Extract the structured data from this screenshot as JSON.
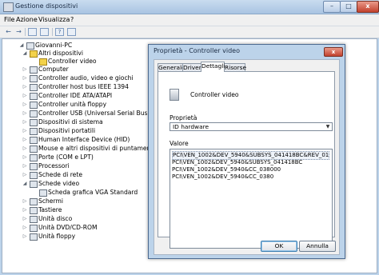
{
  "window": {
    "title": "Gestione dispositivi",
    "min_glyph": "–",
    "max_glyph": "□",
    "close_glyph": "x"
  },
  "menu": {
    "file": "File",
    "azione": "Azione",
    "visualizza": "Visualizza",
    "help": "?"
  },
  "toolbar": {
    "icons": [
      "back-icon",
      "forward-icon",
      "properties-icon",
      "list-icon",
      "help-icon",
      "scan-icon"
    ],
    "back": "←",
    "forward": "→",
    "help": "?"
  },
  "tree": {
    "nodes": [
      {
        "label": "Giovanni-PC",
        "expand": "◢"
      },
      {
        "label": "Altri dispositivi",
        "expand": "◢"
      },
      {
        "label": "Controller video",
        "expand": ""
      },
      {
        "label": "Computer",
        "expand": "▷"
      },
      {
        "label": "Controller audio, video e giochi",
        "expand": "▷"
      },
      {
        "label": "Controller host bus IEEE 1394",
        "expand": "▷"
      },
      {
        "label": "Controller IDE ATA/ATAPI",
        "expand": "▷"
      },
      {
        "label": "Controller unità floppy",
        "expand": "▷"
      },
      {
        "label": "Controller USB (Universal Serial Bus)",
        "expand": "▷"
      },
      {
        "label": "Dispositivi di sistema",
        "expand": "▷"
      },
      {
        "label": "Dispositivi portatili",
        "expand": "▷"
      },
      {
        "label": "Human Interface Device (HID)",
        "expand": "▷"
      },
      {
        "label": "Mouse e altri dispositivi di puntamento",
        "expand": "▷"
      },
      {
        "label": "Porte (COM e LPT)",
        "expand": "▷"
      },
      {
        "label": "Processori",
        "expand": "▷"
      },
      {
        "label": "Schede di rete",
        "expand": "▷"
      },
      {
        "label": "Schede video",
        "expand": "◢"
      },
      {
        "label": "Scheda grafica VGA Standard",
        "expand": ""
      },
      {
        "label": "Schermi",
        "expand": "▷"
      },
      {
        "label": "Tastiere",
        "expand": "▷"
      },
      {
        "label": "Unità disco",
        "expand": "▷"
      },
      {
        "label": "Unità DVD/CD-ROM",
        "expand": "▷"
      },
      {
        "label": "Unità floppy",
        "expand": "▷"
      }
    ]
  },
  "dialog": {
    "title": "Proprietà - Controller video",
    "close_glyph": "x",
    "tabs": [
      "Generale",
      "Driver",
      "Dettagli",
      "Risorse"
    ],
    "active_tab": "Dettagli",
    "device_name": "Controller video",
    "property_label": "Proprietà",
    "property_value": "ID hardware",
    "dropdown_arrow": "▼",
    "value_label": "Valore",
    "values": [
      "PCI\\VEN_1002&DEV_5940&SUBSYS_041418BC&REV_01",
      "PCI\\VEN_1002&DEV_5940&SUBSYS_041418BC",
      "PCI\\VEN_1002&DEV_5940&CC_038000",
      "PCI\\VEN_1002&DEV_5940&CC_0380"
    ],
    "ok": "OK",
    "cancel": "Annulla"
  },
  "colors": {
    "chrome": "#bcd3ea",
    "close_red": "#c2412d",
    "warning_yellow": "#f3d24a"
  }
}
